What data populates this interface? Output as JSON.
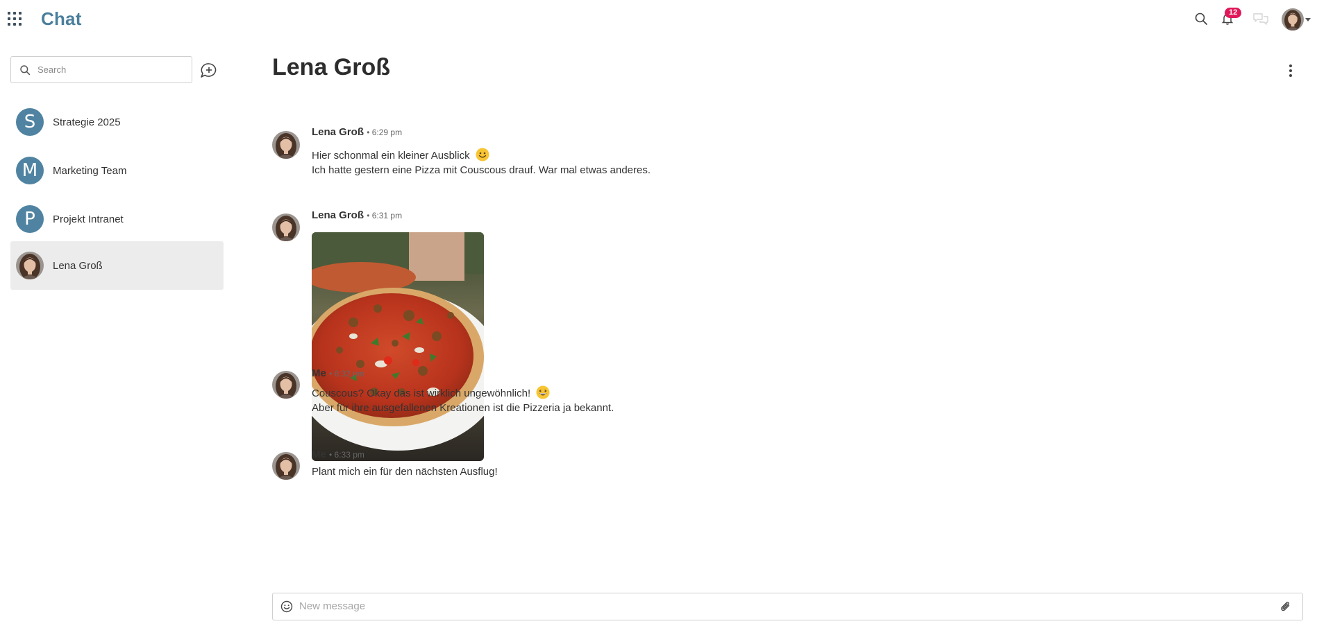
{
  "app": {
    "title": "Chat"
  },
  "topbar": {
    "notification_count": "12",
    "icons": [
      "apps-grid-icon",
      "search-icon",
      "bell-icon",
      "chat-bubbles-icon",
      "user-avatar"
    ]
  },
  "sidebar": {
    "search_placeholder": "Search",
    "items": [
      {
        "initial": "S",
        "label": "Strategie 2025",
        "avatar": "letter"
      },
      {
        "initial": "M",
        "label": "Marketing Team",
        "avatar": "letter"
      },
      {
        "initial": "P",
        "label": "Projekt Intranet",
        "avatar": "letter"
      },
      {
        "initial": "",
        "label": "Lena Groß",
        "avatar": "photo",
        "active": true
      }
    ]
  },
  "conversation": {
    "title": "Lena Groß",
    "messages": [
      {
        "author": "Lena Groß",
        "time": "• 6:29 pm",
        "lines": [
          "Hier schonmal ein kleiner Ausblick",
          "Ich hatte gestern eine Pizza mit Couscous drauf. War mal etwas anderes."
        ],
        "emoji": "slightly-smiling-face"
      },
      {
        "author": "Lena Groß",
        "time": "• 6:31 pm",
        "attachment": "pizza-photo"
      },
      {
        "author": "Me",
        "time": "• 6:32 pm",
        "lines": [
          "Couscous? Okay das ist wirklich ungewöhnlich!",
          "Aber für ihre ausgefallenen Kreationen ist die Pizzeria ja bekannt."
        ],
        "emoji": "grinning-face-with-smiling-eyes"
      },
      {
        "author": "Me",
        "time": "• 6:33 pm",
        "lines": [
          "Plant mich ein für den nächsten Ausflug!"
        ]
      }
    ]
  },
  "composer": {
    "placeholder": "New message"
  },
  "colors": {
    "accent": "#4a7f9c",
    "letter_avatar": "#4f83a1",
    "badge": "#e0185a",
    "active_item": "#ececec"
  }
}
